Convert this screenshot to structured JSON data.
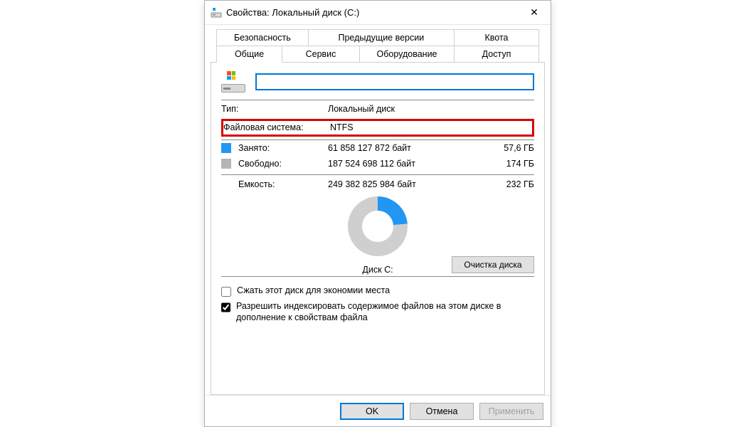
{
  "window": {
    "title": "Свойства: Локальный диск (C:)"
  },
  "tabs": {
    "row1": [
      "Безопасность",
      "Предыдущие версии",
      "Квота"
    ],
    "row2": [
      "Общие",
      "Сервис",
      "Оборудование",
      "Доступ"
    ],
    "active": "Общие"
  },
  "drive": {
    "name_value": "",
    "type_label": "Тип:",
    "type_value": "Локальный диск",
    "fs_label": "Файловая система:",
    "fs_value": "NTFS"
  },
  "usage": {
    "used_label": "Занято:",
    "used_bytes": "61 858 127 872 байт",
    "used_hr": "57,6 ГБ",
    "free_label": "Свободно:",
    "free_bytes": "187 524 698 112 байт",
    "free_hr": "174 ГБ",
    "capacity_label": "Емкость:",
    "capacity_bytes": "249 382 825 984 байт",
    "capacity_hr": "232 ГБ",
    "used_color": "#2196f3",
    "free_color": "#b5b5b5"
  },
  "donut": {
    "label": "Диск C:",
    "cleanup_button": "Очистка диска"
  },
  "options": {
    "compress_label": "Сжать этот диск для экономии места",
    "compress_checked": false,
    "index_label": "Разрешить индексировать содержимое файлов на этом диске в дополнение к свойствам файла",
    "index_checked": true
  },
  "buttons": {
    "ok": "OK",
    "cancel": "Отмена",
    "apply": "Применить"
  },
  "chart_data": {
    "type": "pie",
    "title": "Диск C:",
    "series": [
      {
        "name": "Занято",
        "value": 61858127872,
        "value_hr": "57,6 ГБ",
        "color": "#2196f3"
      },
      {
        "name": "Свободно",
        "value": 187524698112,
        "value_hr": "174 ГБ",
        "color": "#b5b5b5"
      }
    ],
    "total": {
      "name": "Емкость",
      "value": 249382825984,
      "value_hr": "232 ГБ"
    }
  }
}
